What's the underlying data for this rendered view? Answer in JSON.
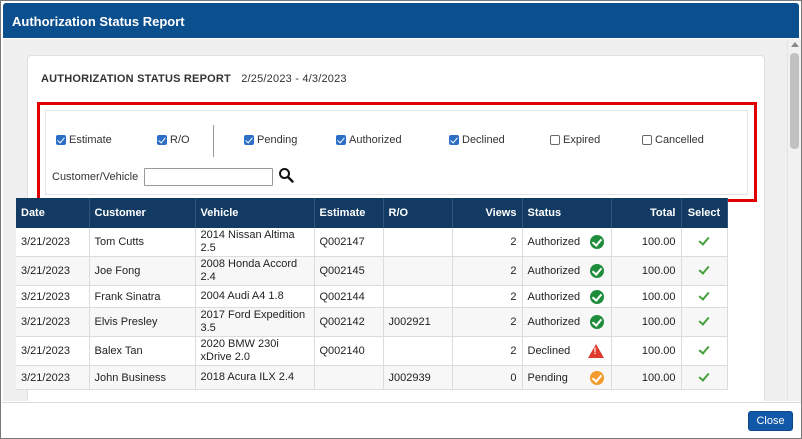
{
  "window": {
    "title": "Authorization Status Report"
  },
  "report": {
    "heading": "AUTHORIZATION STATUS REPORT",
    "date_range": "2/25/2023 - 4/3/2023"
  },
  "filters": {
    "type_checkboxes": [
      {
        "label": "Estimate",
        "checked": true
      },
      {
        "label": "R/O",
        "checked": true
      }
    ],
    "status_checkboxes": [
      {
        "label": "Pending",
        "checked": true
      },
      {
        "label": "Authorized",
        "checked": true
      },
      {
        "label": "Declined",
        "checked": true
      },
      {
        "label": "Expired",
        "checked": false
      },
      {
        "label": "Cancelled",
        "checked": false
      }
    ],
    "customer_vehicle_label": "Customer/Vehicle",
    "customer_vehicle_value": ""
  },
  "table": {
    "headers": [
      "Date",
      "Customer",
      "Vehicle",
      "Estimate",
      "R/O",
      "Views",
      "Status",
      "Total",
      "Select"
    ],
    "rows": [
      {
        "date": "3/21/2023",
        "customer": "Tom Cutts",
        "vehicle": "2014 Nissan Altima 2.5",
        "estimate": "Q002147",
        "ro": "",
        "views": "2",
        "status": "Authorized",
        "status_icon": "check-circle-green",
        "total": "100.00"
      },
      {
        "date": "3/21/2023",
        "customer": "Joe Fong",
        "vehicle": "2008 Honda Accord 2.4",
        "estimate": "Q002145",
        "ro": "",
        "views": "2",
        "status": "Authorized",
        "status_icon": "check-circle-green",
        "total": "100.00"
      },
      {
        "date": "3/21/2023",
        "customer": "Frank Sinatra",
        "vehicle": "2004 Audi A4 1.8",
        "estimate": "Q002144",
        "ro": "",
        "views": "2",
        "status": "Authorized",
        "status_icon": "check-circle-green",
        "total": "100.00"
      },
      {
        "date": "3/21/2023",
        "customer": "Elvis Presley",
        "vehicle": "2017 Ford Expedition 3.5",
        "estimate": "Q002142",
        "ro": "J002921",
        "views": "2",
        "status": "Authorized",
        "status_icon": "check-circle-green",
        "total": "100.00"
      },
      {
        "date": "3/21/2023",
        "customer": "Balex Tan",
        "vehicle": "2020 BMW 230i xDrive 2.0",
        "estimate": "Q002140",
        "ro": "",
        "views": "2",
        "status": "Declined",
        "status_icon": "warning-triangle-red",
        "total": "100.00"
      },
      {
        "date": "3/21/2023",
        "customer": "John Business",
        "vehicle": "2018 Acura ILX 2.4",
        "estimate": "",
        "ro": "J002939",
        "views": "0",
        "status": "Pending",
        "status_icon": "check-circle-orange",
        "total": "100.00"
      }
    ]
  },
  "footer": {
    "close_label": "Close"
  },
  "colors": {
    "titlebar": "#0b4f8f",
    "table_header": "#123a63",
    "highlight_border": "#e00000",
    "close_button": "#1258a8"
  }
}
